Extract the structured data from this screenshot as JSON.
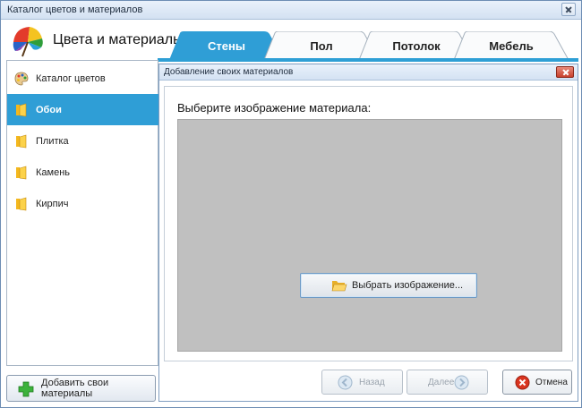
{
  "window": {
    "title": "Каталог цветов и материалов"
  },
  "header": {
    "title": "Цвета и материалы"
  },
  "tabs": [
    {
      "label": "Стены",
      "active": true
    },
    {
      "label": "Пол",
      "active": false
    },
    {
      "label": "Потолок",
      "active": false
    },
    {
      "label": "Мебель",
      "active": false
    }
  ],
  "sidebar": {
    "items": [
      {
        "label": "Каталог цветов",
        "icon": "palette-icon"
      },
      {
        "label": "Обои",
        "icon": "folder-icon",
        "active": true
      },
      {
        "label": "Плитка",
        "icon": "folder-icon"
      },
      {
        "label": "Камень",
        "icon": "folder-icon"
      },
      {
        "label": "Кирпич",
        "icon": "folder-icon"
      }
    ],
    "add_button": "Добавить свои материалы"
  },
  "dialog": {
    "title": "Добавление своих материалов",
    "prompt": "Выберите изображение материала:",
    "choose_button": "Выбрать изображение...",
    "back_button": "Назад",
    "next_button": "Далее",
    "cancel_button": "Отмена"
  },
  "colors": {
    "accent": "#2f9ed6",
    "preview_bg": "#c0c0c0",
    "cancel_icon": "#d9341f",
    "add_icon": "#2fa52f"
  }
}
